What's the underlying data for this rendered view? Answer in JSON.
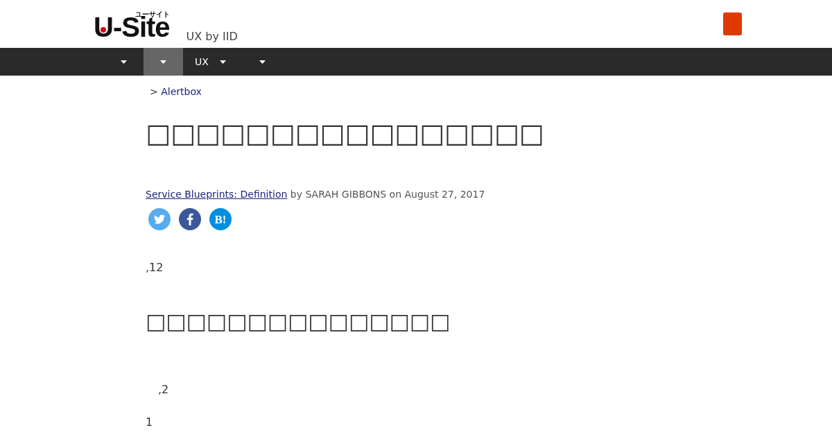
{
  "header": {
    "logo": "U-Site",
    "logo_kana": "ユーサイト",
    "tagline": "UX by IID"
  },
  "nav": [
    {
      "selected": false
    },
    {
      "selected": true
    },
    {
      "label": "UX",
      "selected": false
    },
    {
      "selected": false
    }
  ],
  "breadcrumb": {
    "separator": ">",
    "link": "Alertbox"
  },
  "title": "□□□□□□□□□□□□□□□□",
  "byline": {
    "link": "Service Blueprints: Definition",
    "text": "by SARAH GIBBONS on August 27, 2017"
  },
  "share": [
    {
      "kind": "twitter"
    },
    {
      "kind": "facebook"
    },
    {
      "kind": "hatena",
      "label": "B!"
    }
  ],
  "paragraph_1": ",12",
  "heading_2": "□□□□□□□□□□□□□□□",
  "paragraph_2": ",2",
  "paragraph_3": "1"
}
